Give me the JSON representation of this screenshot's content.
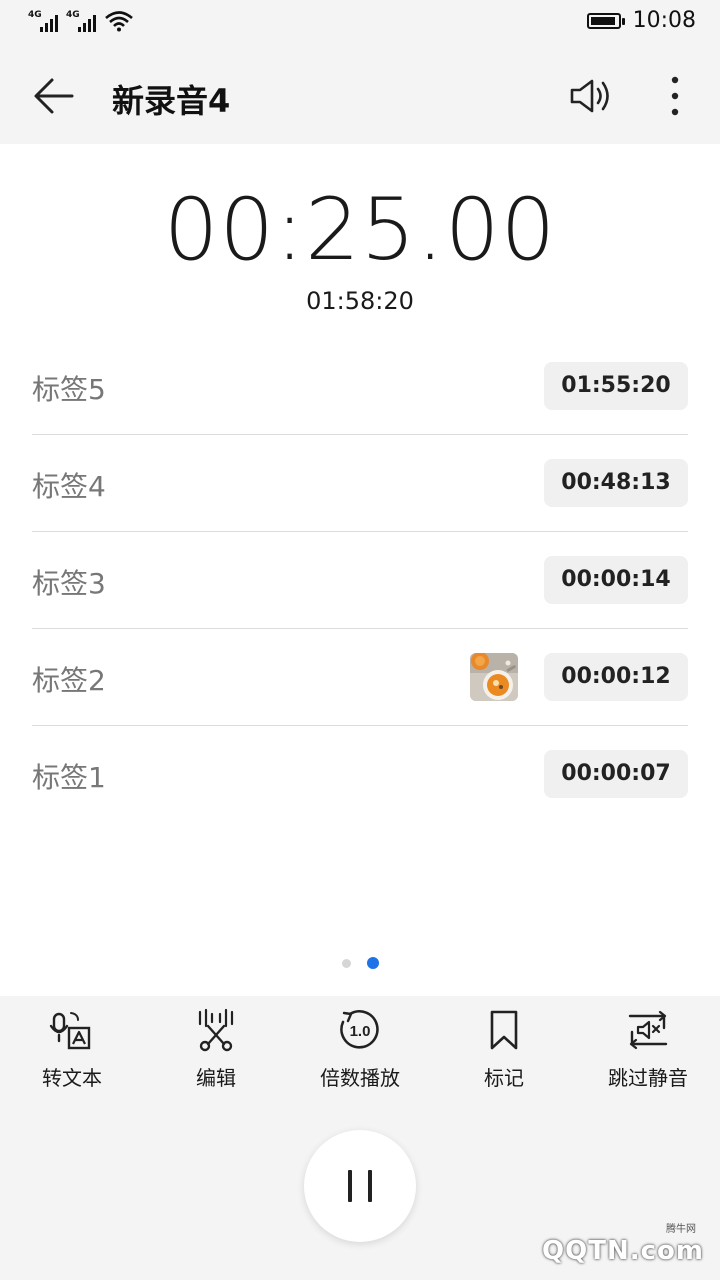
{
  "status_bar": {
    "signal_1_tag": "4G",
    "signal_2_tag": "4G",
    "wifi_icon": "wifi-icon",
    "battery_level": 0.95,
    "time": "10:08"
  },
  "header": {
    "back_icon": "arrow-left-icon",
    "title": "新录音4",
    "speaker_icon": "speaker-icon",
    "more_icon": "more-vertical-icon"
  },
  "timer": {
    "elapsed": "00:25.00",
    "total": "01:58:20"
  },
  "tags": [
    {
      "label": "标签5",
      "time": "01:55:20",
      "has_image": false
    },
    {
      "label": "标签4",
      "time": "00:48:13",
      "has_image": false
    },
    {
      "label": "标签3",
      "time": "00:00:14",
      "has_image": false
    },
    {
      "label": "标签2",
      "time": "00:00:12",
      "has_image": true
    },
    {
      "label": "标签1",
      "time": "00:00:07",
      "has_image": false
    }
  ],
  "page_indicator": {
    "count": 2,
    "active": 2
  },
  "toolbar": {
    "to_text": {
      "label": "转文本",
      "icon": "speech-to-text-icon"
    },
    "edit": {
      "label": "编辑",
      "icon": "scissors-waveform-icon"
    },
    "speed": {
      "label": "倍数播放",
      "icon": "speed-1x-icon",
      "value": "1.0"
    },
    "mark": {
      "label": "标记",
      "icon": "bookmark-icon"
    },
    "skip_silence": {
      "label": "跳过静音",
      "icon": "skip-silence-icon"
    }
  },
  "pause_icon": "pause-icon",
  "watermark": {
    "text": "QQTN.com",
    "small": "腾牛网"
  },
  "colors": {
    "accent": "#1f73e6",
    "background": "#ffffff",
    "panel": "#f4f4f4"
  }
}
